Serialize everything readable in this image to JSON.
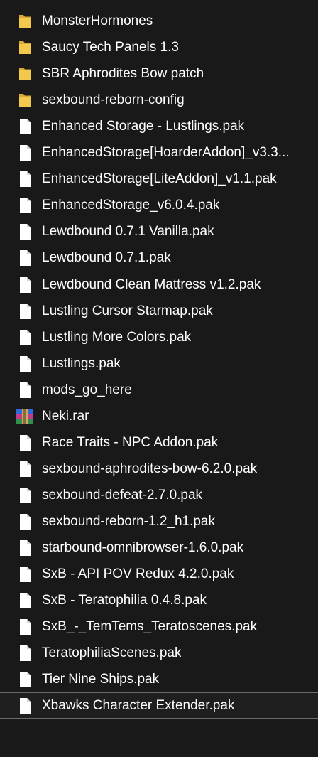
{
  "files": [
    {
      "name": "MonsterHormones",
      "icon": "folder-icon",
      "type": "folder"
    },
    {
      "name": "Saucy Tech Panels 1.3",
      "icon": "folder-icon",
      "type": "folder"
    },
    {
      "name": "SBR Aphrodites Bow patch",
      "icon": "folder-icon",
      "type": "folder"
    },
    {
      "name": "sexbound-reborn-config",
      "icon": "folder-icon",
      "type": "folder"
    },
    {
      "name": "Enhanced Storage - Lustlings.pak",
      "icon": "file-icon",
      "type": "file"
    },
    {
      "name": "EnhancedStorage[HoarderAddon]_v3.3...",
      "icon": "file-icon",
      "type": "file"
    },
    {
      "name": "EnhancedStorage[LiteAddon]_v1.1.pak",
      "icon": "file-icon",
      "type": "file"
    },
    {
      "name": "EnhancedStorage_v6.0.4.pak",
      "icon": "file-icon",
      "type": "file"
    },
    {
      "name": "Lewdbound 0.7.1 Vanilla.pak",
      "icon": "file-icon",
      "type": "file"
    },
    {
      "name": "Lewdbound 0.7.1.pak",
      "icon": "file-icon",
      "type": "file"
    },
    {
      "name": "Lewdbound Clean Mattress v1.2.pak",
      "icon": "file-icon",
      "type": "file"
    },
    {
      "name": "Lustling Cursor Starmap.pak",
      "icon": "file-icon",
      "type": "file"
    },
    {
      "name": "Lustling More Colors.pak",
      "icon": "file-icon",
      "type": "file"
    },
    {
      "name": "Lustlings.pak",
      "icon": "file-icon",
      "type": "file"
    },
    {
      "name": "mods_go_here",
      "icon": "file-icon",
      "type": "file"
    },
    {
      "name": "Neki.rar",
      "icon": "archive-icon",
      "type": "archive"
    },
    {
      "name": "Race Traits - NPC Addon.pak",
      "icon": "file-icon",
      "type": "file"
    },
    {
      "name": "sexbound-aphrodites-bow-6.2.0.pak",
      "icon": "file-icon",
      "type": "file"
    },
    {
      "name": "sexbound-defeat-2.7.0.pak",
      "icon": "file-icon",
      "type": "file"
    },
    {
      "name": "sexbound-reborn-1.2_h1.pak",
      "icon": "file-icon",
      "type": "file"
    },
    {
      "name": "starbound-omnibrowser-1.6.0.pak",
      "icon": "file-icon",
      "type": "file"
    },
    {
      "name": "SxB - API POV Redux 4.2.0.pak",
      "icon": "file-icon",
      "type": "file"
    },
    {
      "name": "SxB - Teratophilia 0.4.8.pak",
      "icon": "file-icon",
      "type": "file"
    },
    {
      "name": "SxB_-_TemTems_Teratoscenes.pak",
      "icon": "file-icon",
      "type": "file"
    },
    {
      "name": "TeratophiliaScenes.pak",
      "icon": "file-icon",
      "type": "file"
    },
    {
      "name": "Tier Nine Ships.pak",
      "icon": "file-icon",
      "type": "file"
    },
    {
      "name": "Xbawks Character Extender.pak",
      "icon": "file-icon",
      "type": "file",
      "selected": true
    }
  ],
  "colors": {
    "background": "#191919",
    "text": "#ffffff",
    "folder": "#f2c94c",
    "file": "#ffffff",
    "selection_border": "#6b6b6b"
  }
}
